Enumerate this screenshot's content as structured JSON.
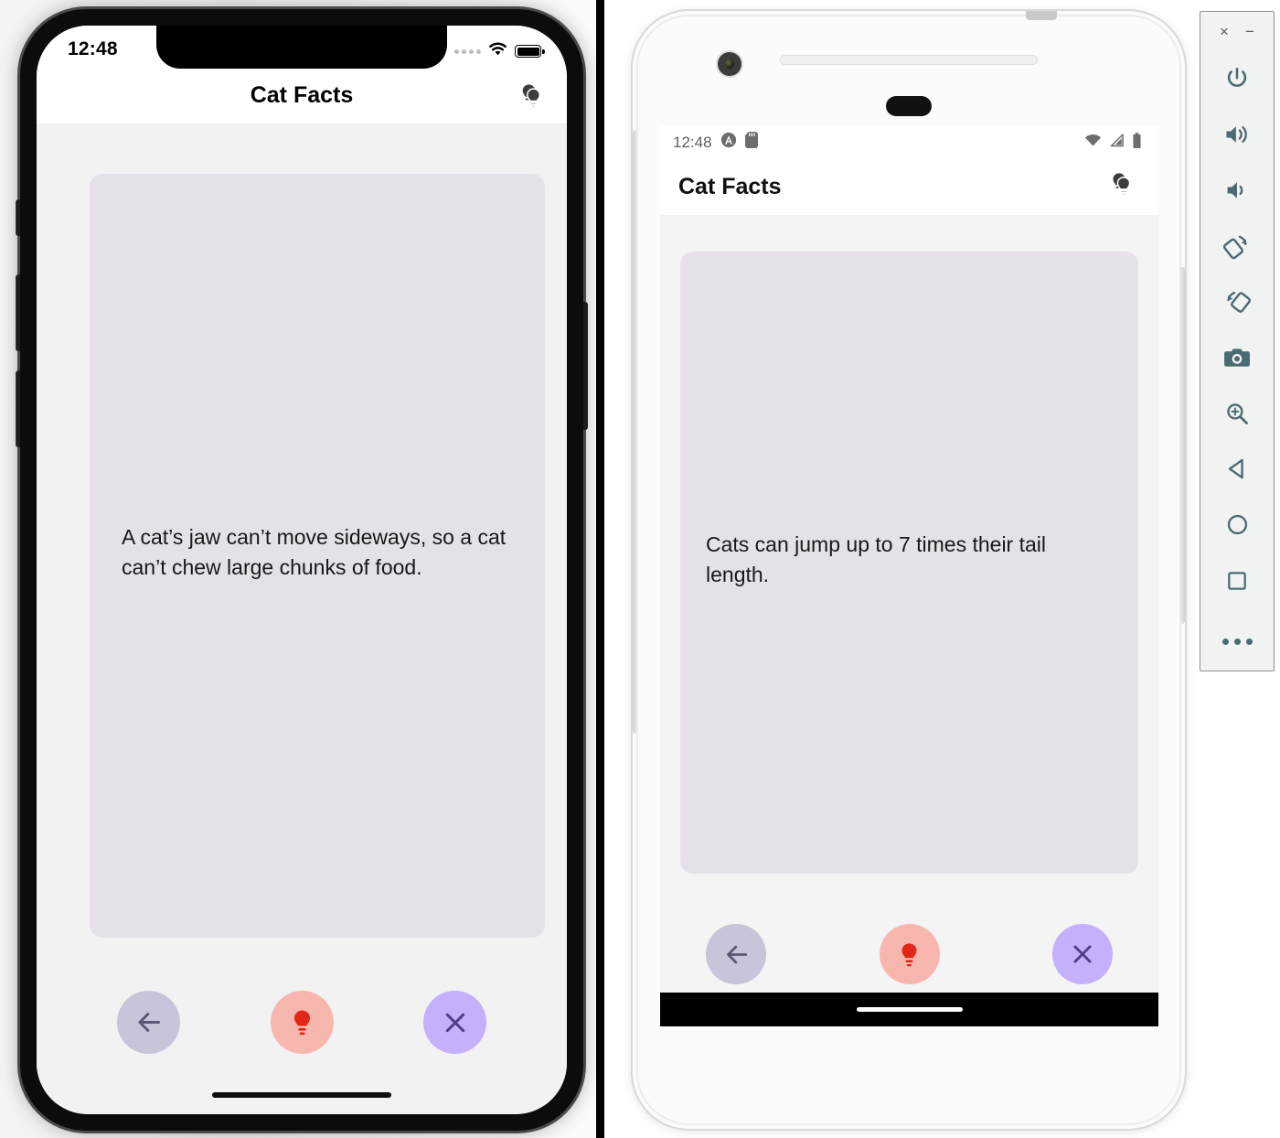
{
  "panels": {
    "ios": {
      "platform_name": "iOS",
      "status_bar": {
        "time": "12:48",
        "signal_icon": "signal-dots-icon",
        "wifi_icon": "wifi-icon",
        "battery_icon": "battery-full-icon"
      },
      "app_bar": {
        "title": "Cat Facts",
        "action_icon": "double-lightbulb-icon"
      },
      "card": {
        "fact_text": "A cat’s jaw can’t move sideways, so a cat can’t chew large chunks of food.",
        "background_color": "#e6e1e9"
      },
      "buttons": [
        {
          "name": "previous-fact-button",
          "icon": "arrow-left-icon",
          "color": "#c9c4da",
          "icon_color": "#5b5674"
        },
        {
          "name": "new-fact-button",
          "icon": "lightbulb-icon",
          "color": "#f7b7ae",
          "icon_color": "#e02718"
        },
        {
          "name": "close-button",
          "icon": "close-x-icon",
          "color": "#c4b0fb",
          "icon_color": "#503e8c"
        }
      ],
      "home_indicator": "home-indicator"
    },
    "android": {
      "platform_name": "Android",
      "status_bar": {
        "time": "12:48",
        "app_badge_icon": "circle-a-icon",
        "sdcard_icon": "sd-card-icon",
        "wifi_icon": "wifi-icon",
        "signal_icon": "cell-signal-icon",
        "battery_icon": "battery-full-icon"
      },
      "app_bar": {
        "title": "Cat Facts",
        "action_icon": "double-lightbulb-icon"
      },
      "card": {
        "fact_text": "Cats can jump up to 7 times their tail length.",
        "background_color": "#e6e1e9"
      },
      "buttons": [
        {
          "name": "previous-fact-button",
          "icon": "arrow-left-icon",
          "color": "#c9c4da",
          "icon_color": "#5b5674"
        },
        {
          "name": "new-fact-button",
          "icon": "lightbulb-icon",
          "color": "#f7b7ae",
          "icon_color": "#e02718"
        },
        {
          "name": "close-button",
          "icon": "close-x-icon",
          "color": "#c4b0fb",
          "icon_color": "#503e8c"
        }
      ],
      "nav_bar": {
        "gesture_pill": "gesture-pill"
      }
    }
  },
  "emulator_toolbar": {
    "window_buttons": [
      {
        "name": "close-window-button",
        "glyph": "×"
      },
      {
        "name": "minimize-window-button",
        "glyph": "−"
      }
    ],
    "items": [
      {
        "name": "power-button",
        "icon": "power-icon"
      },
      {
        "name": "volume-up-button",
        "icon": "volume-up-icon"
      },
      {
        "name": "volume-down-button",
        "icon": "volume-down-icon"
      },
      {
        "name": "rotate-left-button",
        "icon": "rotate-left-icon"
      },
      {
        "name": "rotate-right-button",
        "icon": "rotate-right-icon"
      },
      {
        "name": "screenshot-button",
        "icon": "camera-icon"
      },
      {
        "name": "zoom-button",
        "icon": "magnifier-plus-icon"
      },
      {
        "name": "back-button",
        "icon": "triangle-back-icon"
      },
      {
        "name": "home-button",
        "icon": "circle-home-icon"
      },
      {
        "name": "overview-button",
        "icon": "square-overview-icon"
      },
      {
        "name": "more-button",
        "icon": "ellipsis-icon"
      }
    ],
    "accent_color": "#4c6a72",
    "background_color": "#f1f2f2"
  }
}
